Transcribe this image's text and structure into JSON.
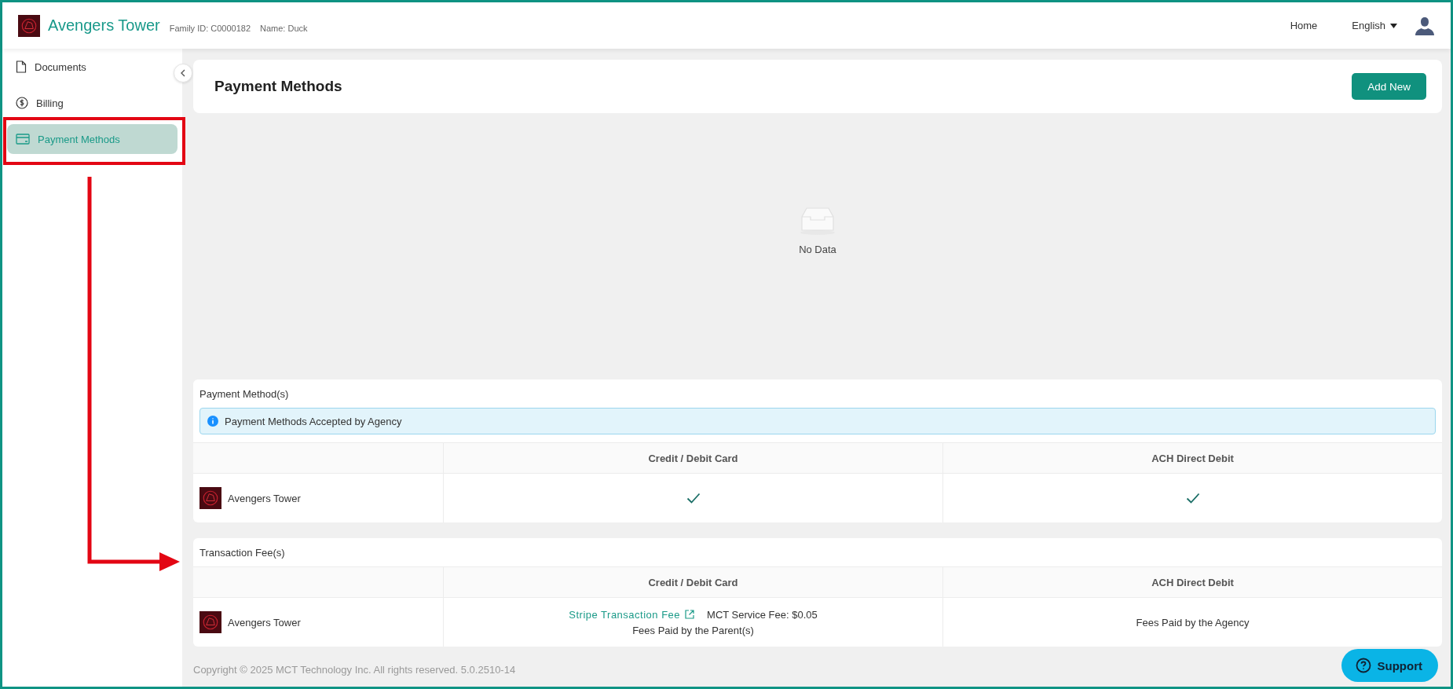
{
  "header": {
    "org_name": "Avengers Tower",
    "family_id": "Family ID: C0000182",
    "name": "Name: Duck",
    "nav": [
      "Home"
    ],
    "language": "English"
  },
  "sidebar": {
    "items": [
      {
        "label": "Documents",
        "kind": "document",
        "selected": false
      },
      {
        "label": "Billing",
        "kind": "dollar",
        "selected": false
      },
      {
        "label": "Payment Methods",
        "kind": "card",
        "selected": true
      }
    ]
  },
  "page": {
    "title": "Payment Methods",
    "add_button": "Add New",
    "empty_text": "No Data"
  },
  "methods": {
    "title": "Payment Method(s)",
    "notice": "Payment Methods Accepted by Agency",
    "columns": [
      "Credit / Debit Card",
      "ACH Direct Debit"
    ],
    "rows": [
      {
        "org": "Avengers Tower",
        "accepted": [
          true,
          true
        ]
      }
    ]
  },
  "fees": {
    "title": "Transaction Fee(s)",
    "columns": [
      "Credit / Debit Card",
      "ACH Direct Debit"
    ],
    "rows": [
      {
        "org": "Avengers Tower",
        "card_link": "Stripe Transaction Fee",
        "card_service_fee": "MCT Service Fee: $0.05",
        "card_paid_by": "Fees Paid by the Parent(s)",
        "ach_paid_by": "Fees Paid by the Agency"
      }
    ]
  },
  "footer": "Copyright © 2025 MCT Technology Inc. All rights reserved. 5.0.2510-14",
  "support_button": "Support"
}
